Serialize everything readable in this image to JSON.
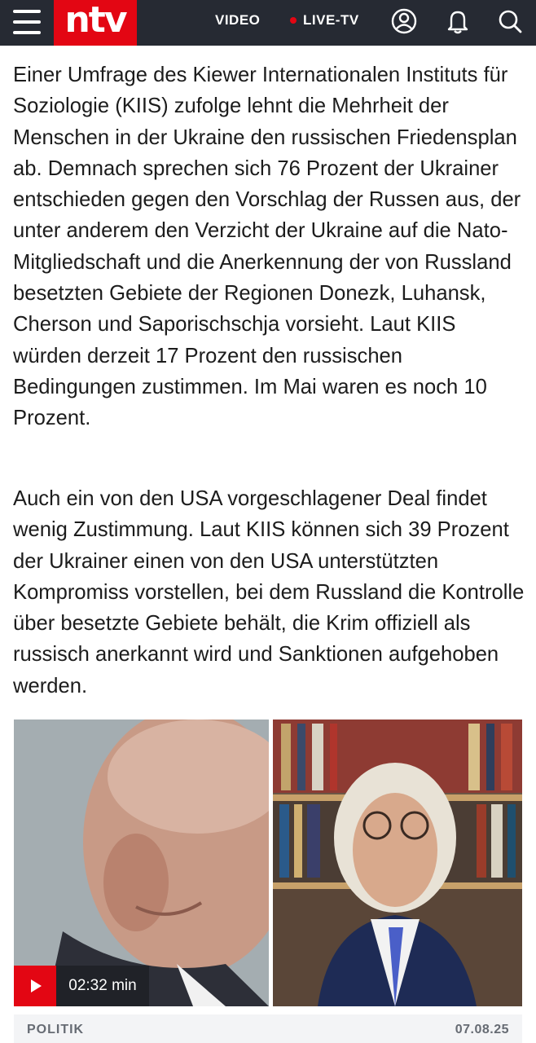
{
  "header": {
    "logo_text": "ntv",
    "nav_video": "VIDEO",
    "nav_live": "LIVE-TV",
    "icons": [
      "menu-icon",
      "user-icon",
      "bell-icon",
      "search-icon"
    ],
    "colors": {
      "bar": "#262a33",
      "brand_red": "#e30613"
    }
  },
  "article": {
    "paragraph_1": "Einer Umfrage des Kiewer Internationalen Instituts für Soziologie (KIIS) zufolge lehnt die Mehrheit der Menschen in der Ukraine den russischen Friedensplan ab. Demnach sprechen sich 76 Prozent der Ukrainer entschieden gegen den Vorschlag der Russen aus, der unter anderem den Verzicht der Ukraine auf die Nato-Mitgliedschaft und die Anerkennung der von Russland besetzten Gebiete der Regionen Donezk, Luhansk, Cherson und Saporischschja vorsieht. Laut KIIS würden derzeit 17 Prozent den russischen Bedingungen zustimmen. Im Mai waren es noch 10 Prozent.",
    "paragraph_2": "Auch ein von den USA vorgeschlagener Deal findet wenig Zustimmung. Laut KIIS können sich 39 Prozent der Ukrainer einen von den USA unterstützten Kompromiss vorstellen, bei dem Russland die Kontrolle über besetzte Gebiete behält, die Krim offiziell als russisch anerkannt wird und Sanktionen aufgehoben werden."
  },
  "video_teaser": {
    "duration": "02:32 min",
    "category": "POLITIK",
    "date": "07.08.25"
  }
}
